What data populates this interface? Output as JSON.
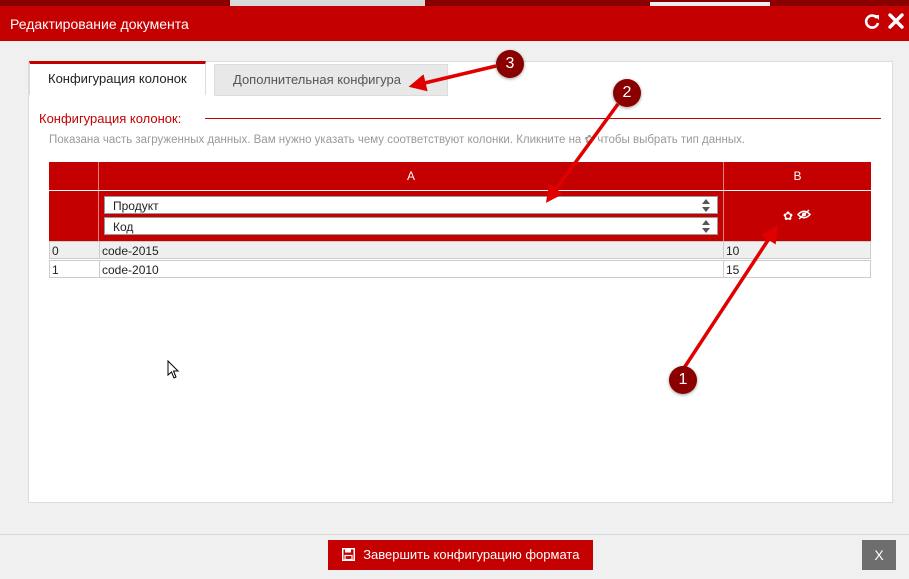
{
  "window": {
    "title": "Редактирование документа",
    "refresh_icon": "refresh-icon",
    "close_icon": "close-icon"
  },
  "tabs": [
    {
      "label": "Конфигурация колонок",
      "active": true
    },
    {
      "label": "Дополнительная конфигура",
      "active": false
    }
  ],
  "section": {
    "title": "Конфигурация колонок:",
    "hint_part1": "Показана часть загруженных данных. Вам нужно указать чему соответствуют колонки. Кликните на",
    "hint_part2": "чтобы выбрать тип данных."
  },
  "grid": {
    "columns": [
      "A",
      "B"
    ],
    "column_a_selects": [
      "Продукт",
      "Код"
    ],
    "rows": [
      [
        "0",
        "code-2015",
        "10"
      ],
      [
        "1",
        "code-2010",
        "15"
      ]
    ]
  },
  "footer": {
    "finish_label": "Завершить конфигурацию формата",
    "close_label": "X"
  },
  "annotations": [
    "1",
    "2",
    "3"
  ],
  "colors": {
    "accent": "#c40000",
    "annotation": "#8a0000",
    "arrow": "#e00000"
  }
}
